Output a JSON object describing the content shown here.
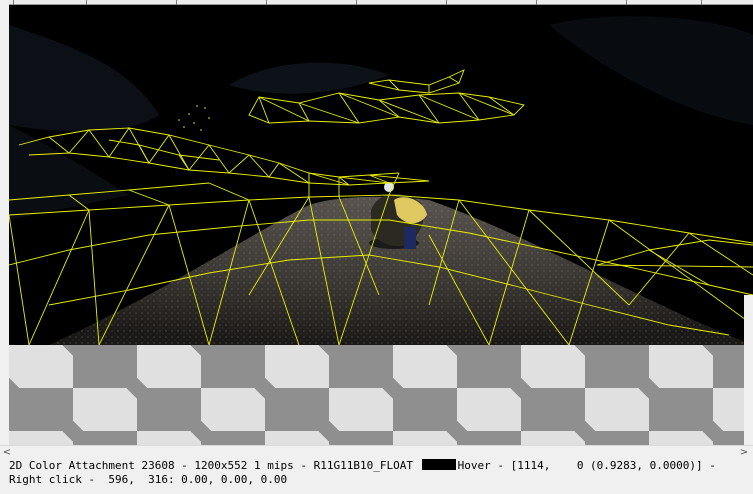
{
  "status_bar": {
    "attachment_info": "2D Color Attachment 23608 - 1200x552 1 mips - R11G11B10_FLOAT",
    "hover_label": "Hover - [1114,    0 (0.9283, 0.0000)] -",
    "right_click_info": "Right click -  596,  316: 0.00, 0.00, 0.00",
    "swatch_color": "#000000"
  },
  "scrollbar": {
    "left_arrow": "<",
    "right_arrow": ">"
  },
  "viewport": {
    "content": "wireframe-overlay-render",
    "wireframe_color": "#e8f000"
  },
  "background_pattern": "checkerboard"
}
